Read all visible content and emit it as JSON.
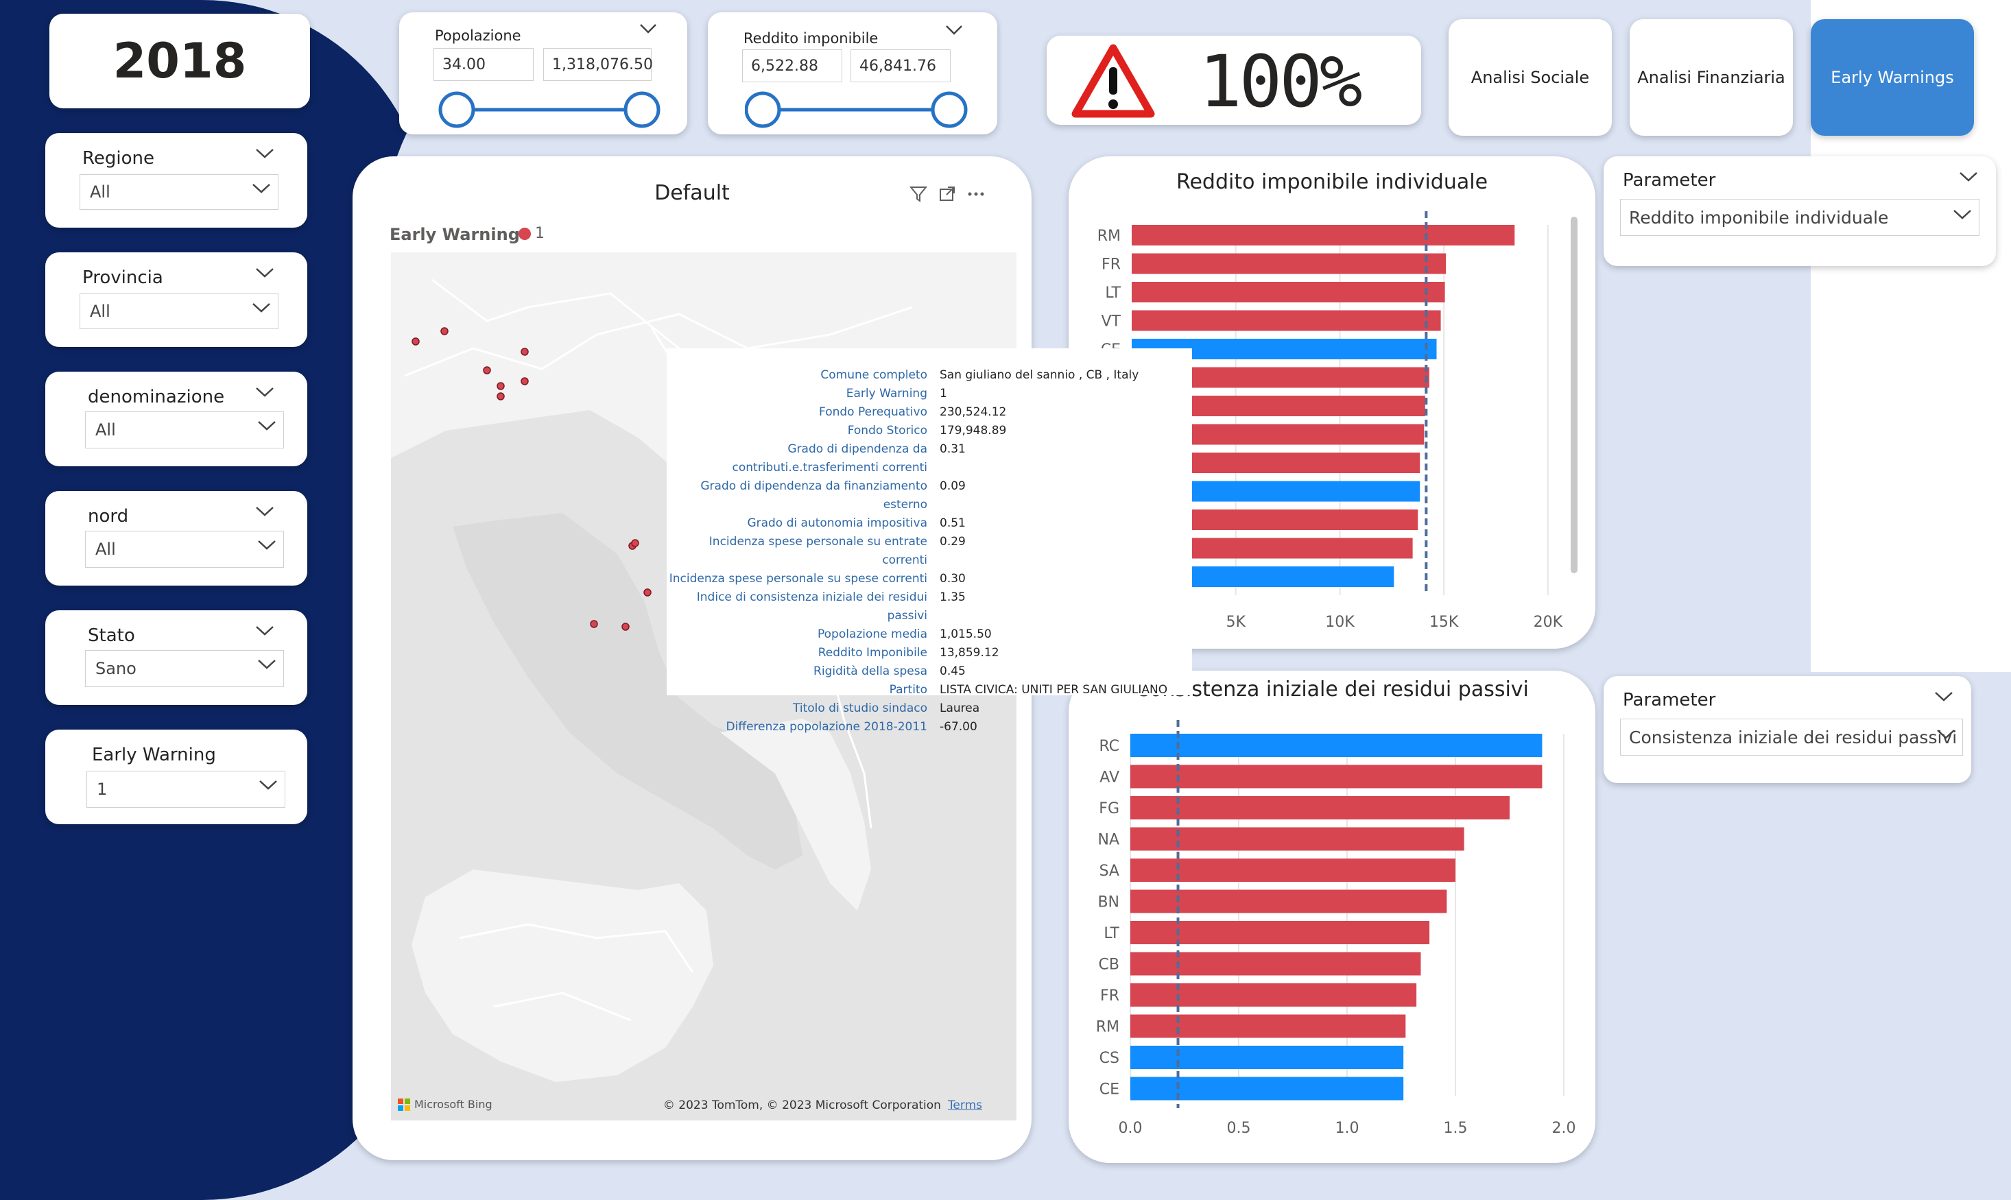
{
  "year": "2018",
  "slicers": [
    {
      "title": "Regione",
      "value": "All"
    },
    {
      "title": "Provincia",
      "value": "All"
    },
    {
      "title": "denominazione",
      "value": "All"
    },
    {
      "title": "nord",
      "value": "All"
    },
    {
      "title": "Stato",
      "value": "Sano"
    },
    {
      "title": "Early Warning",
      "value": "1"
    }
  ],
  "range_slicers": {
    "popolazione": {
      "title": "Popolazione",
      "min": "34.00",
      "max": "1,318,076.50"
    },
    "reddito": {
      "title": "Reddito imponibile",
      "min": "6,522.88",
      "max": "46,841.76"
    }
  },
  "kpi": {
    "value": "100%"
  },
  "nav": {
    "social": "Analisi Sociale",
    "financial": "Analisi Finanziaria",
    "early": "Early Warnings"
  },
  "map": {
    "title": "Default",
    "legend_title": "Early Warning",
    "legend_value": "1",
    "bing": "Microsoft Bing",
    "copyright": "© 2023 TomTom, © 2023 Microsoft Corporation",
    "terms": "Terms"
  },
  "tooltip": [
    {
      "k": "Comune completo",
      "v": "San giuliano del sannio , CB , Italy"
    },
    {
      "k": "Early Warning",
      "v": "1"
    },
    {
      "k": "Fondo Perequativo",
      "v": "230,524.12"
    },
    {
      "k": "Fondo Storico",
      "v": "179,948.89"
    },
    {
      "k": "Grado di dipendenza da",
      "v": "0.31"
    },
    {
      "k": "contributi.e.trasferimenti correnti",
      "v": ""
    },
    {
      "k": "Grado di dipendenza da finanziamento esterno",
      "v": "0.09"
    },
    {
      "k": "Grado di autonomia impositiva",
      "v": "0.51"
    },
    {
      "k": "Incidenza spese personale su entrate correnti",
      "v": "0.29"
    },
    {
      "k": "Incidenza spese personale su spese correnti",
      "v": "0.30"
    },
    {
      "k": "Indice di consistenza iniziale dei residui passivi",
      "v": "1.35"
    },
    {
      "k": "Popolazione media",
      "v": "1,015.50"
    },
    {
      "k": "Reddito Imponibile",
      "v": "13,859.12"
    },
    {
      "k": "Rigidità della spesa",
      "v": "0.45"
    },
    {
      "k": "Partito",
      "v": "LISTA CIVICA: UNITI PER SAN GIULIANO"
    },
    {
      "k": "Titolo di studio sindaco",
      "v": "Laurea"
    },
    {
      "k": "Differenza popolazione 2018-2011",
      "v": "-67.00"
    }
  ],
  "params": [
    {
      "title": "Parameter",
      "value": "Reddito imponibile individuale"
    },
    {
      "title": "Parameter",
      "value": "Consistenza iniziale dei residui passivi"
    }
  ],
  "colors": {
    "red": "#d64550",
    "blue": "#118dff",
    "navy": "#0c2461",
    "accent": "#3a86d4"
  },
  "chart_data": [
    {
      "type": "bar",
      "orientation": "horizontal",
      "title": "Reddito imponibile individuale",
      "categories": [
        "RM",
        "FR",
        "LT",
        "VT",
        "CE",
        "",
        "",
        "",
        "",
        "",
        "",
        "",
        ""
      ],
      "values": [
        18400,
        15100,
        15050,
        14850,
        14650,
        14300,
        14100,
        14050,
        13850,
        13850,
        13750,
        13500,
        12600
      ],
      "bar_colors": [
        "red",
        "red",
        "red",
        "red",
        "blue",
        "red",
        "red",
        "red",
        "red",
        "blue",
        "red",
        "red",
        "blue"
      ],
      "xticks": [
        "5K",
        "10K",
        "15K",
        "20K"
      ],
      "xlim": [
        0,
        20500
      ],
      "reference_line": 14150
    },
    {
      "type": "bar",
      "orientation": "horizontal",
      "title": "Consistenza iniziale dei residui passivi",
      "categories": [
        "RC",
        "AV",
        "FG",
        "NA",
        "SA",
        "BN",
        "LT",
        "CB",
        "FR",
        "RM",
        "CS",
        "CE"
      ],
      "values": [
        1.9,
        1.9,
        1.75,
        1.54,
        1.5,
        1.46,
        1.38,
        1.34,
        1.32,
        1.27,
        1.26,
        1.26
      ],
      "bar_colors": [
        "blue",
        "red",
        "red",
        "red",
        "red",
        "red",
        "red",
        "red",
        "red",
        "red",
        "blue",
        "blue"
      ],
      "xticks": [
        "0.0",
        "0.5",
        "1.0",
        "1.5",
        "2.0"
      ],
      "xlim": [
        0,
        2.0
      ],
      "reference_line": 0.22
    }
  ]
}
